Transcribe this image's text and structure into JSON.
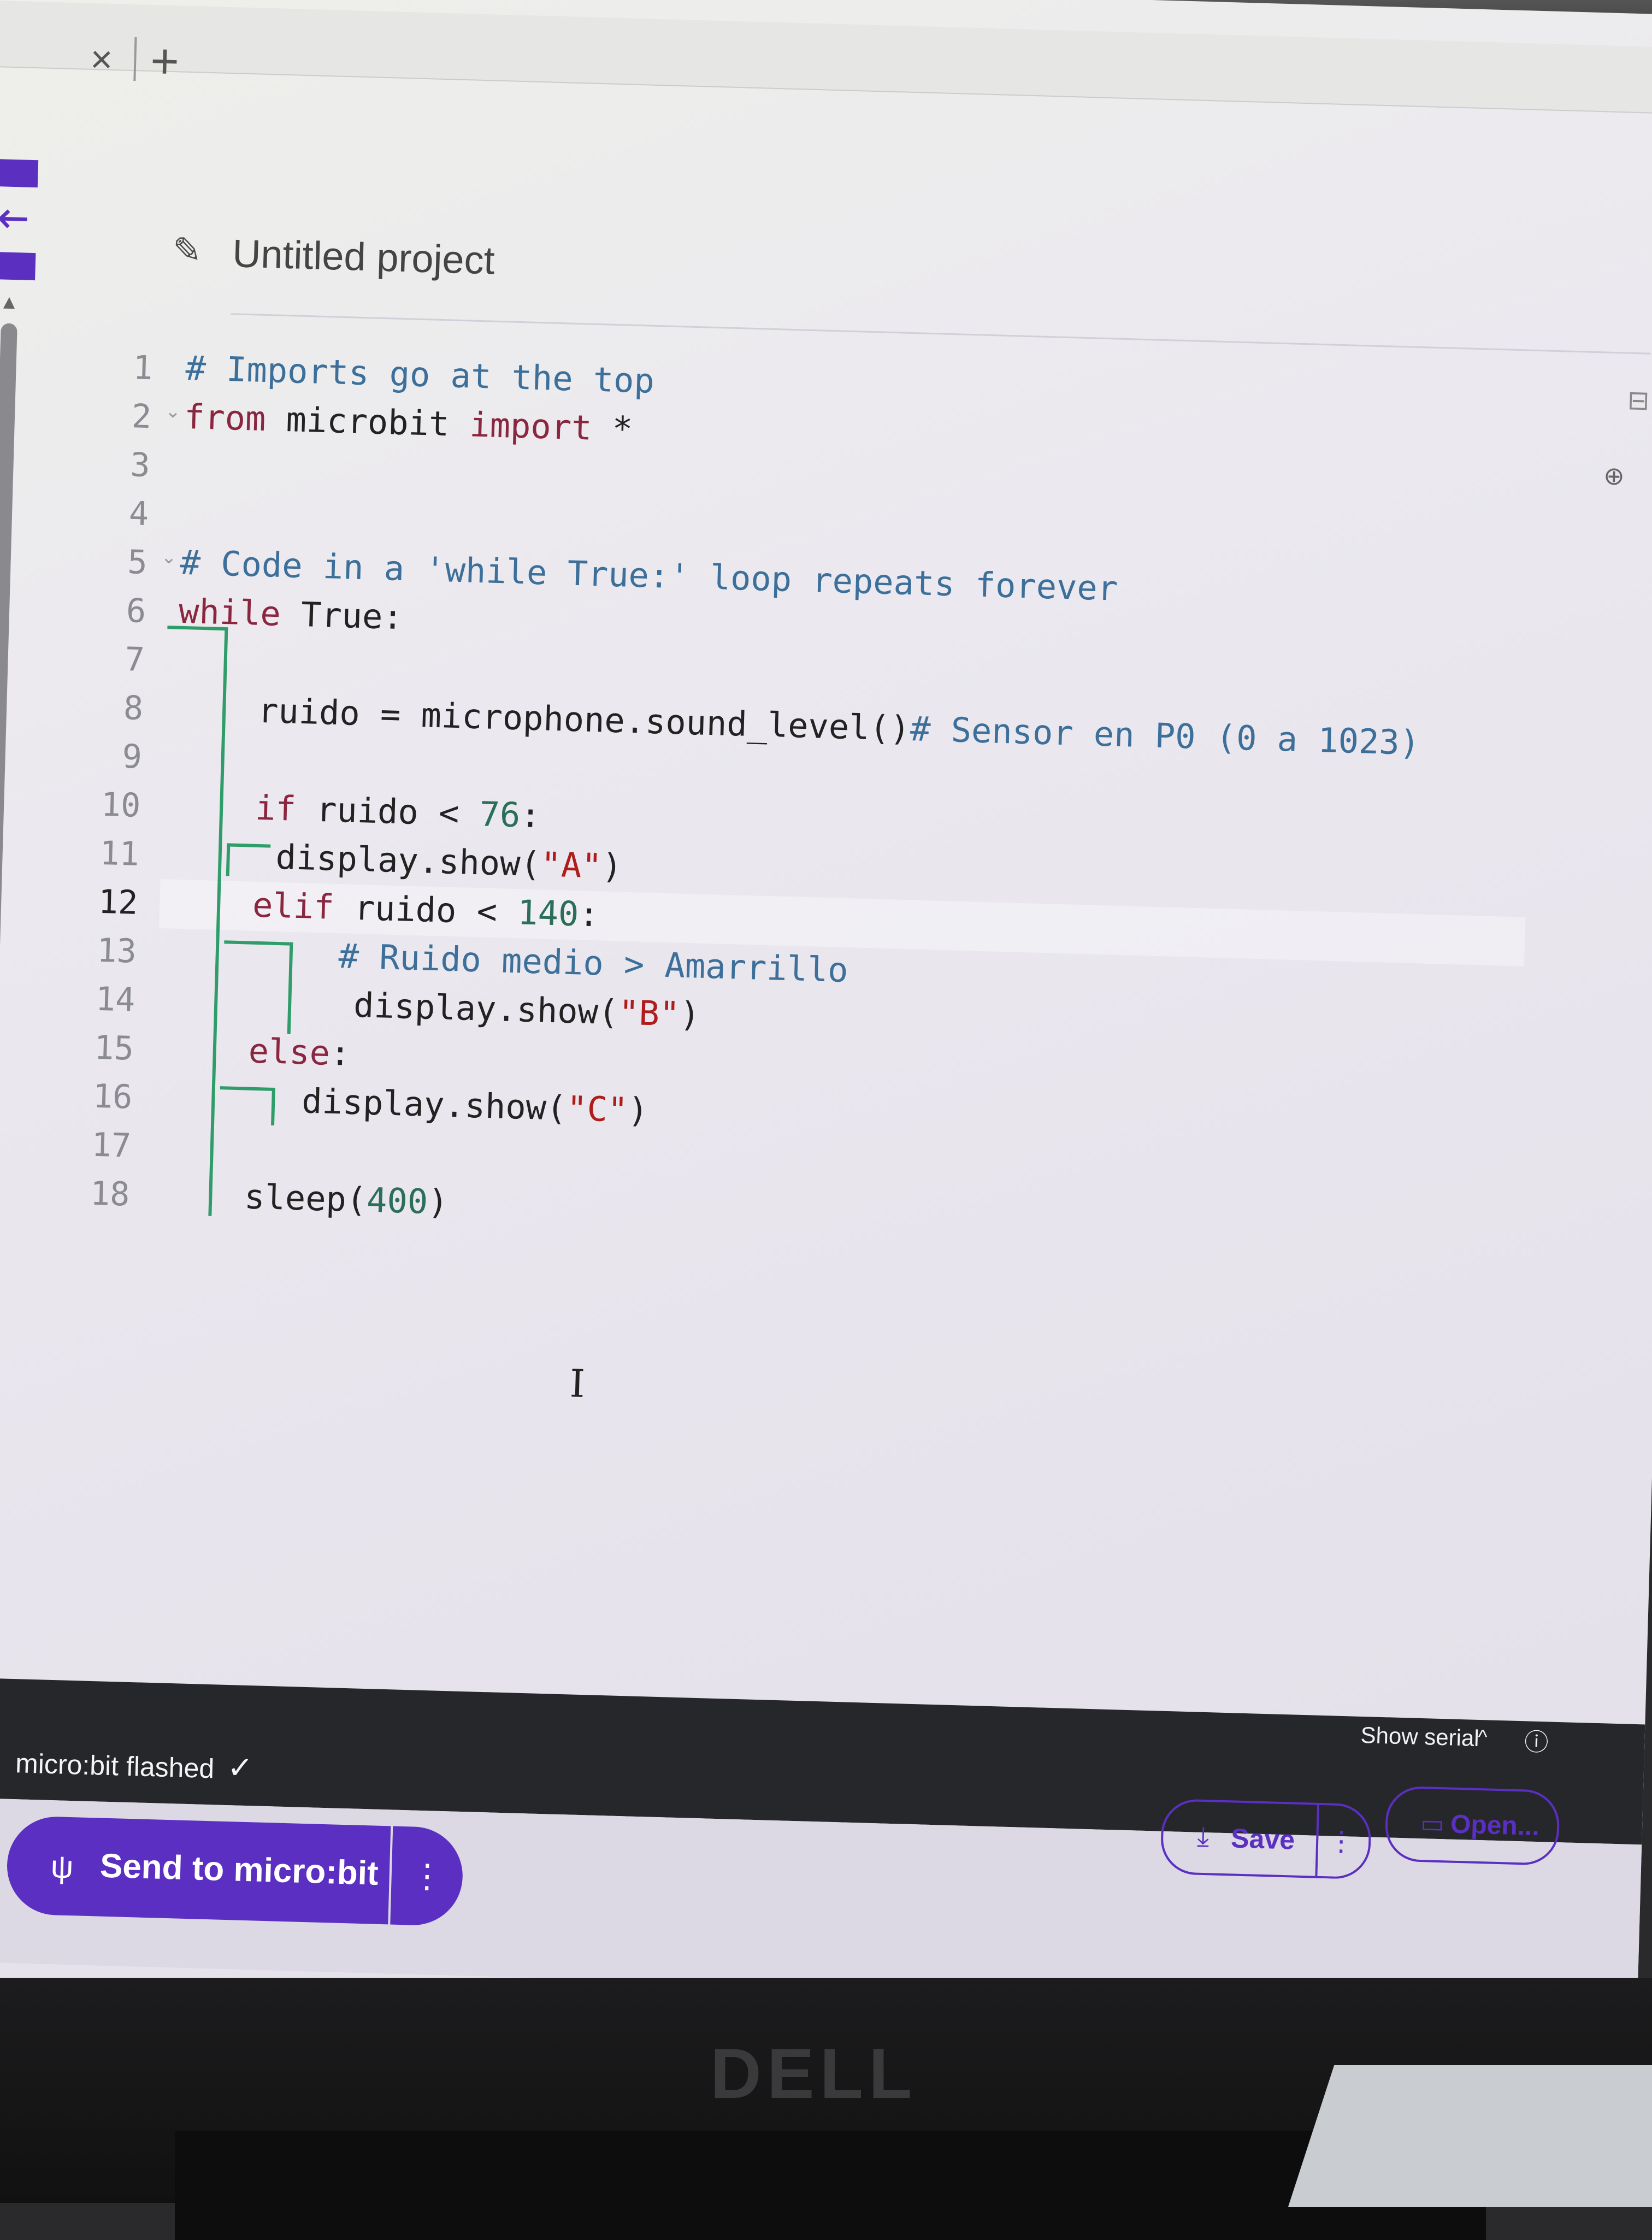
{
  "tabs": {
    "close_glyph": "×",
    "new_glyph": "+"
  },
  "header": {
    "title": "Untitled project",
    "pencil_icon": "pencil-icon"
  },
  "editor": {
    "line_numbers": [
      "1",
      "2",
      "3",
      "4",
      "5",
      "6",
      "7",
      "8",
      "9",
      "10",
      "11",
      "12",
      "13",
      "14",
      "15",
      "16",
      "17",
      "18"
    ],
    "active_line": 12,
    "lines": [
      {
        "n": 1,
        "segments": [
          {
            "t": "# Imports go at the top",
            "c": "cm"
          }
        ]
      },
      {
        "n": 2,
        "segments": [
          {
            "t": "from",
            "c": "kw"
          },
          {
            "t": " microbit ",
            "c": ""
          },
          {
            "t": "import",
            "c": "kw"
          },
          {
            "t": " *",
            "c": ""
          }
        ]
      },
      {
        "n": 3,
        "segments": []
      },
      {
        "n": 4,
        "segments": []
      },
      {
        "n": 5,
        "segments": [
          {
            "t": "# Code in a 'while True:' loop repeats forever",
            "c": "cm"
          }
        ]
      },
      {
        "n": 6,
        "segments": [
          {
            "t": "while",
            "c": "kw"
          },
          {
            "t": " True:",
            "c": ""
          }
        ]
      },
      {
        "n": 7,
        "segments": []
      },
      {
        "n": 8,
        "segments": [
          {
            "t": "ruido = microphone.sound_level()",
            "c": ""
          },
          {
            "t": "# Sensor en P0 (0 a 1023)",
            "c": "cm"
          }
        ]
      },
      {
        "n": 9,
        "segments": []
      },
      {
        "n": 10,
        "segments": [
          {
            "t": "if",
            "c": "kw"
          },
          {
            "t": " ruido < ",
            "c": ""
          },
          {
            "t": "76",
            "c": "nm"
          },
          {
            "t": ":",
            "c": ""
          }
        ]
      },
      {
        "n": 11,
        "segments": [
          {
            "t": "display.show(",
            "c": ""
          },
          {
            "t": "\"A\"",
            "c": "str"
          },
          {
            "t": ")",
            "c": ""
          }
        ]
      },
      {
        "n": 12,
        "segments": [
          {
            "t": "elif",
            "c": "kw"
          },
          {
            "t": " ruido < ",
            "c": ""
          },
          {
            "t": "140",
            "c": "nm"
          },
          {
            "t": ":",
            "c": ""
          }
        ]
      },
      {
        "n": 13,
        "segments": [
          {
            "t": "# Ruido medio > Amarrillo",
            "c": "cm"
          }
        ]
      },
      {
        "n": 14,
        "segments": [
          {
            "t": "display.show(",
            "c": ""
          },
          {
            "t": "\"B\"",
            "c": "str"
          },
          {
            "t": ")",
            "c": ""
          }
        ]
      },
      {
        "n": 15,
        "segments": [
          {
            "t": "else",
            "c": "kw"
          },
          {
            "t": ":",
            "c": ""
          }
        ]
      },
      {
        "n": 16,
        "segments": [
          {
            "t": "display.show(",
            "c": ""
          },
          {
            "t": "\"C\"",
            "c": "str"
          },
          {
            "t": ")",
            "c": ""
          }
        ]
      },
      {
        "n": 17,
        "segments": []
      },
      {
        "n": 18,
        "segments": [
          {
            "t": "sleep(",
            "c": ""
          },
          {
            "t": "400",
            "c": "nm"
          },
          {
            "t": ")",
            "c": ""
          }
        ]
      }
    ]
  },
  "serial": {
    "label": "Show serial",
    "chevron": "^",
    "info_icon": "info-icon"
  },
  "status": {
    "text": "micro:bit flashed",
    "check": "✓"
  },
  "actions": {
    "send_label": "Send to micro:bit",
    "more_glyph": "⋮",
    "save_label": "Save",
    "open_label": "Open..."
  },
  "monitor": {
    "brand": "DELL"
  },
  "colors": {
    "accent": "#5a2fc2",
    "toolbar": "#25272b",
    "guide": "#2f9d6a"
  }
}
